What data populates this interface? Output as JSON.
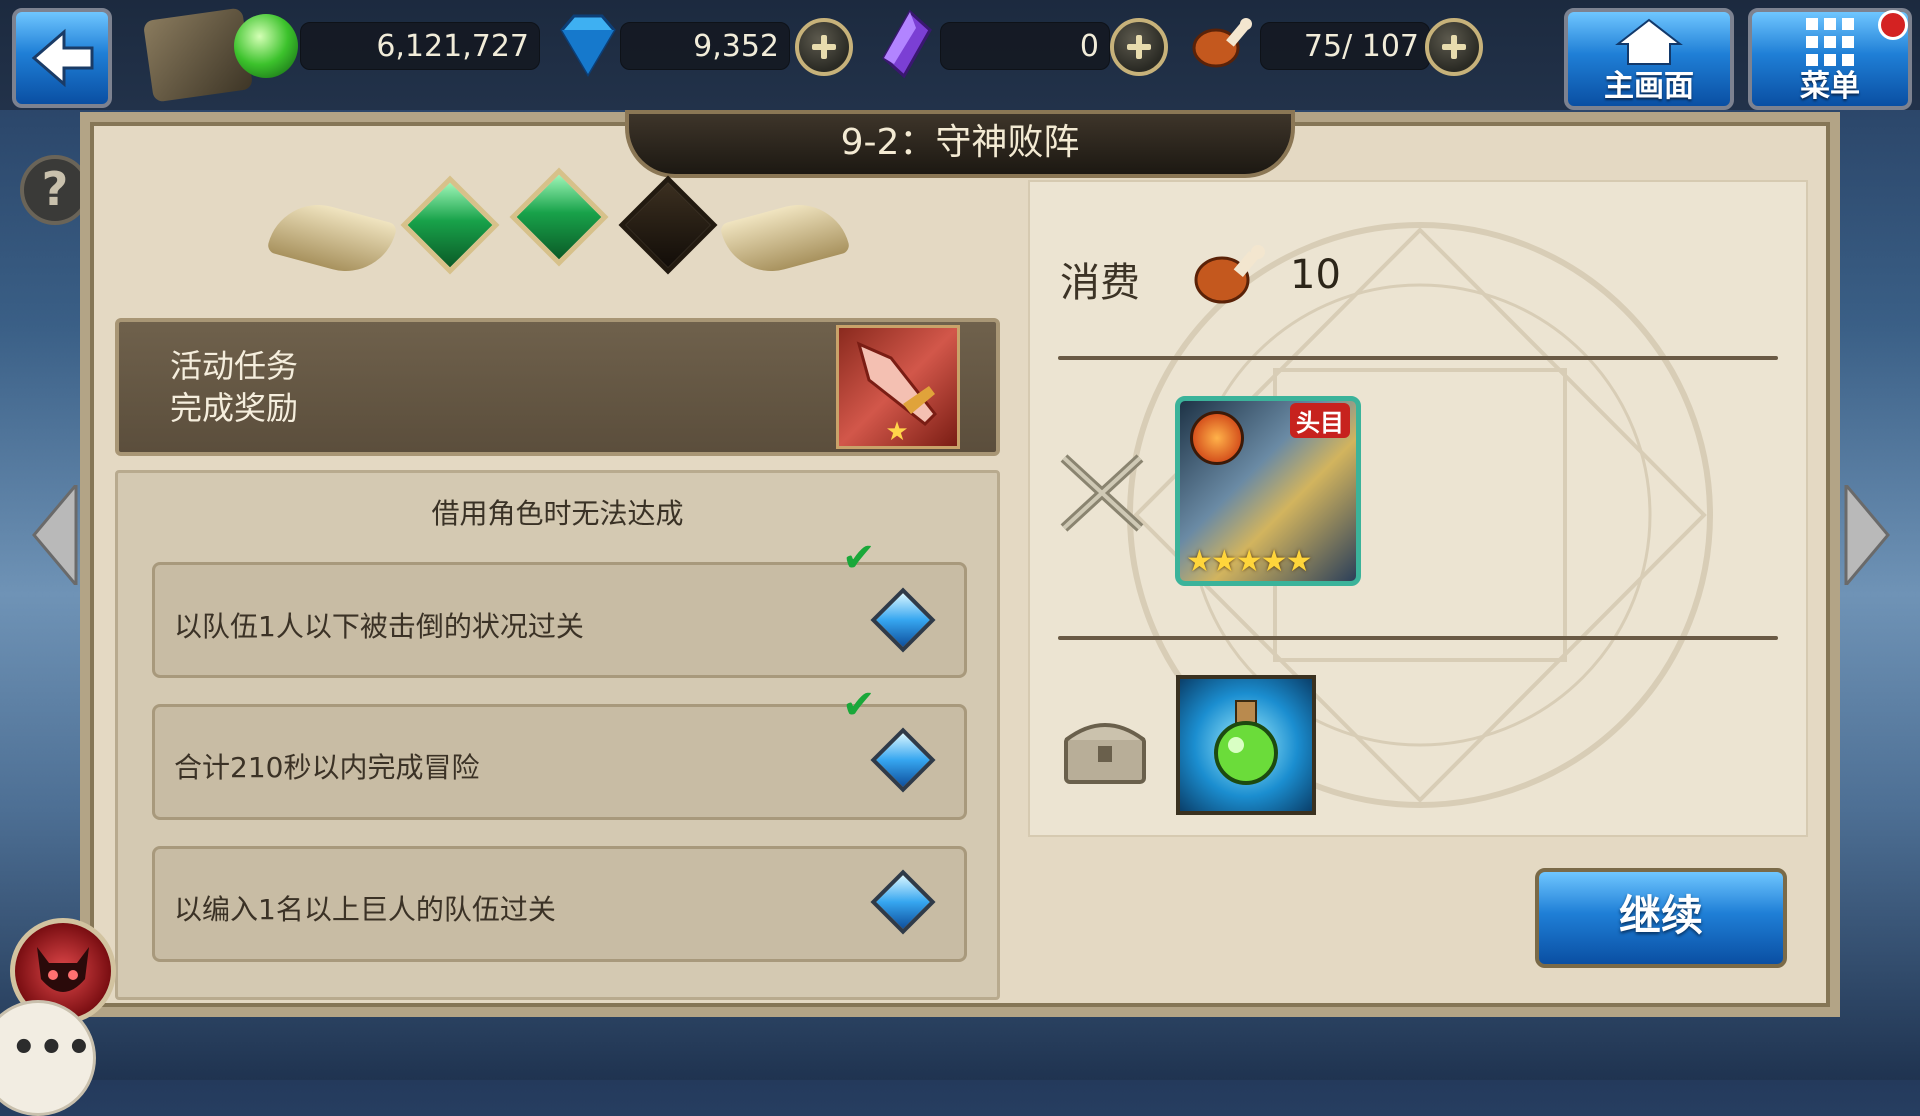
{
  "top_bar": {
    "gold": "6,121,727",
    "gems": "9,352",
    "crystals": "0",
    "stamina": "75/ 107",
    "home_label": "主画面",
    "menu_label": "菜单"
  },
  "stage": {
    "title": "9-2：守神败阵",
    "stars_earned": 2,
    "stars_total": 3
  },
  "mission": {
    "line1": "活动任务",
    "line2": "完成奖励"
  },
  "conditions": {
    "note": "借用角色时无法达成",
    "items": [
      {
        "text": "以队伍1人以下被击倒的状况过关",
        "completed": true
      },
      {
        "text": "合计210秒以内完成冒险",
        "completed": true
      },
      {
        "text": "以编入1名以上巨人的队伍过关",
        "completed": false
      }
    ]
  },
  "cost": {
    "label": "消费",
    "value": "10"
  },
  "boss": {
    "badge": "头目",
    "stars": "★★★★★"
  },
  "continue_label": "继续",
  "colors": {
    "gem_blue": "#36a6f0",
    "emerald": "#18a24a",
    "panel": "#e4d9c3",
    "check": "#1aa83a"
  },
  "icons": {
    "back": "back-arrow-icon",
    "scroll": "scroll-icon",
    "gold": "green-orb-icon",
    "gem": "blue-diamond-icon",
    "crystal": "purple-crystal-icon",
    "stamina": "meat-icon",
    "help": "question-icon",
    "battle": "crossed-swords-icon",
    "chest": "treasure-chest-icon",
    "potion": "green-potion-icon",
    "demon": "demon-face-icon",
    "chat": "ellipsis-icon"
  }
}
